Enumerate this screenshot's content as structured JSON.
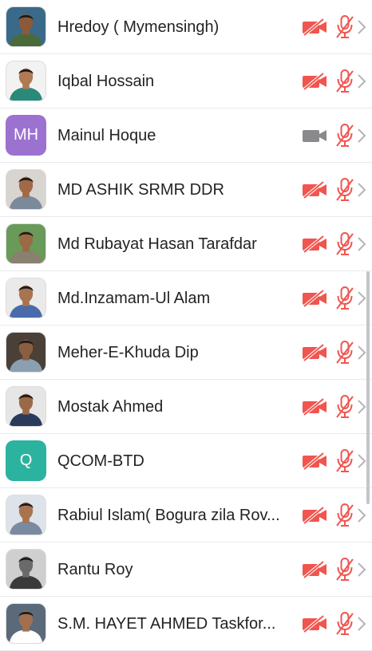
{
  "participants": [
    {
      "name": "Hredoy ( Mymensingh)",
      "avatar": {
        "type": "photo",
        "bg": "#3a6a8a",
        "skin": "#8a5a3a",
        "shirt": "#4a6a3a"
      },
      "video_on": false,
      "mic_muted": true
    },
    {
      "name": "Iqbal Hossain",
      "avatar": {
        "type": "photo",
        "bg": "#f2f2f2",
        "skin": "#b07a55",
        "shirt": "#2a8a7a"
      },
      "video_on": false,
      "mic_muted": true
    },
    {
      "name": "Mainul Hoque",
      "avatar": {
        "type": "initials",
        "initials": "MH",
        "color": "#9b72cf"
      },
      "video_on": true,
      "mic_muted": true
    },
    {
      "name": "MD ASHIK SRMR DDR",
      "avatar": {
        "type": "photo",
        "bg": "#d8d4cf",
        "skin": "#a06a48",
        "shirt": "#7a8a9a"
      },
      "video_on": false,
      "mic_muted": true
    },
    {
      "name": "Md Rubayat Hasan Tarafdar",
      "avatar": {
        "type": "photo",
        "bg": "#6a9a5a",
        "skin": "#9a6a45",
        "shirt": "#8a8070"
      },
      "video_on": false,
      "mic_muted": true
    },
    {
      "name": "Md.Inzamam-Ul Alam",
      "avatar": {
        "type": "photo",
        "bg": "#eaeaea",
        "skin": "#a87450",
        "shirt": "#4a6aaa"
      },
      "video_on": false,
      "mic_muted": true
    },
    {
      "name": "Meher-E-Khuda Dip",
      "avatar": {
        "type": "photo",
        "bg": "#4a4038",
        "skin": "#8a5e40",
        "shirt": "#8aa0b0"
      },
      "video_on": false,
      "mic_muted": true
    },
    {
      "name": "Mostak Ahmed",
      "avatar": {
        "type": "photo",
        "bg": "#e6e6e6",
        "skin": "#9a6a48",
        "shirt": "#2a3a5a"
      },
      "video_on": false,
      "mic_muted": true
    },
    {
      "name": "QCOM-BTD",
      "avatar": {
        "type": "initials",
        "initials": "Q",
        "color": "#2bb3a0"
      },
      "video_on": false,
      "mic_muted": true
    },
    {
      "name": "Rabiul Islam( Bogura zila Rov...",
      "avatar": {
        "type": "photo",
        "bg": "#dde3e8",
        "skin": "#a87450",
        "shirt": "#7a8aa0"
      },
      "video_on": false,
      "mic_muted": true
    },
    {
      "name": "Rantu Roy",
      "avatar": {
        "type": "photo",
        "bg": "#cfcfcf",
        "skin": "#6a6a6a",
        "shirt": "#3a3a3a"
      },
      "video_on": false,
      "mic_muted": true
    },
    {
      "name": "S.M. HAYET AHMED Taskfor...",
      "avatar": {
        "type": "photo",
        "bg": "#5a6a7a",
        "skin": "#a07050",
        "shirt": "#ffffff"
      },
      "video_on": false,
      "mic_muted": true
    }
  ],
  "colors": {
    "muted_red": "#f0554f",
    "video_on_gray": "#8a8a8d",
    "chevron": "#b5b5b8",
    "divider": "#e9e9ec"
  },
  "icons": {
    "video_off": "video-off-icon",
    "video_on": "video-icon",
    "mic_off": "mic-off-icon",
    "chevron": "chevron-right-icon"
  }
}
